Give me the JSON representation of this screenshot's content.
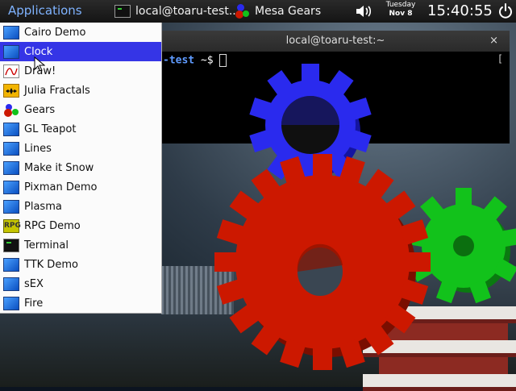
{
  "panel": {
    "applications_label": "Applications",
    "tasks": [
      {
        "label": "local@toaru-test...",
        "icon": "terminal-icon"
      },
      {
        "label": "Mesa Gears",
        "icon": "gears-icon"
      }
    ],
    "date_day": "Tuesday",
    "date_md": "Nov 8",
    "time": "15:40:55",
    "icons": [
      "volume-icon",
      "power-icon"
    ]
  },
  "terminal": {
    "title": "local@toaru-test:~",
    "close_label": "×",
    "prompt_user": "-test",
    "prompt_rest": " ~$ ",
    "scroll_mark": "["
  },
  "menu": {
    "items": [
      {
        "label": "Cairo Demo",
        "icon": "app-icon"
      },
      {
        "label": "Clock",
        "icon": "app-icon",
        "selected": true
      },
      {
        "label": "Draw!",
        "icon": "draw-icon"
      },
      {
        "label": "Julia Fractals",
        "icon": "julia-icon"
      },
      {
        "label": "Gears",
        "icon": "gears-icon"
      },
      {
        "label": "GL Teapot",
        "icon": "app-icon"
      },
      {
        "label": "Lines",
        "icon": "app-icon"
      },
      {
        "label": "Make it Snow",
        "icon": "app-icon"
      },
      {
        "label": "Pixman Demo",
        "icon": "app-icon"
      },
      {
        "label": "Plasma",
        "icon": "app-icon"
      },
      {
        "label": "RPG Demo",
        "icon": "rpg-icon",
        "icon_text": "RPG"
      },
      {
        "label": "Terminal",
        "icon": "terminal-icon"
      },
      {
        "label": "TTK Demo",
        "icon": "app-icon"
      },
      {
        "label": "sEX",
        "icon": "app-icon"
      },
      {
        "label": "Fire",
        "icon": "app-icon"
      }
    ]
  },
  "colors": {
    "menu_selection": "#3535e6",
    "gear_blue": "#2a2aee",
    "gear_red": "#cc1800",
    "gear_green": "#12c21b",
    "applications_text": "#7fb3ff"
  }
}
